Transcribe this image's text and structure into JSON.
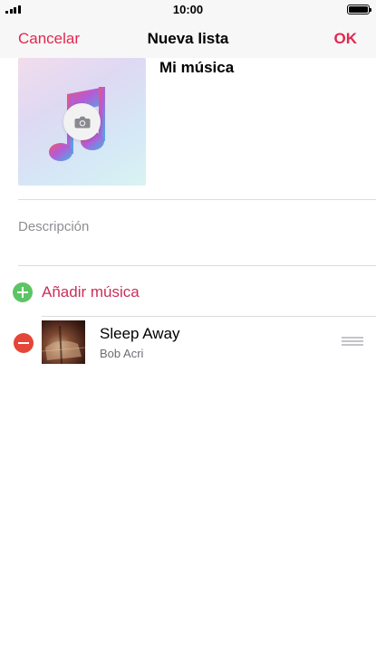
{
  "status_bar": {
    "time": "10:00"
  },
  "nav": {
    "cancel_label": "Cancelar",
    "title": "Nueva lista",
    "ok_label": "OK"
  },
  "playlist": {
    "name": "Mi música",
    "description_placeholder": "Descripción"
  },
  "add_music": {
    "label": "Añadir música"
  },
  "songs": [
    {
      "title": "Sleep Away",
      "artist": "Bob Acri"
    }
  ],
  "colors": {
    "accent": "#e0294e",
    "add_green": "#5dc465",
    "remove_red": "#e64537",
    "secondary_text": "#8e8e93"
  },
  "icons": {
    "signal": "signal-icon",
    "battery": "battery-icon",
    "artwork": "music-note-icon",
    "camera": "camera-icon",
    "add": "add-circle-icon",
    "remove": "remove-circle-icon",
    "reorder": "reorder-handle-icon"
  }
}
